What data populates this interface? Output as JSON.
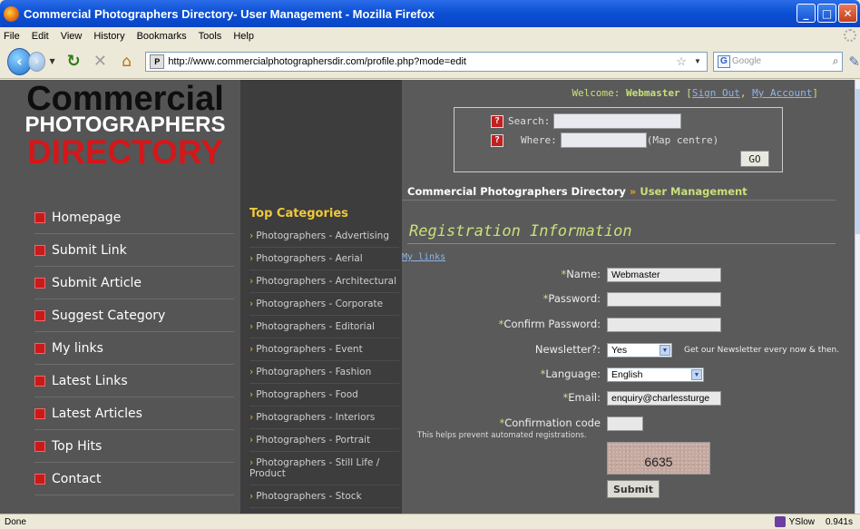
{
  "window": {
    "title": "Commercial Photographers Directory- User Management - Mozilla Firefox",
    "buttons": {
      "minimize": "_",
      "maximize": "□",
      "close": "✕"
    }
  },
  "menu": [
    "File",
    "Edit",
    "View",
    "History",
    "Bookmarks",
    "Tools",
    "Help"
  ],
  "toolbar": {
    "url": "http://www.commercialphotographersdir.com/profile.php?mode=edit",
    "search_placeholder": "Google"
  },
  "logo": {
    "line1": "Commercial",
    "line2": "PHOTOGRAPHERS",
    "line3": "DIRECTORY"
  },
  "leftnav": [
    "Homepage",
    "Submit Link",
    "Submit Article",
    "Suggest Category",
    "My links",
    "Latest Links",
    "Latest Articles",
    "Top Hits",
    "Contact"
  ],
  "categories": {
    "title": "Top Categories",
    "items": [
      "Photographers - Advertising",
      "Photographers - Aerial",
      "Photographers - Architectural",
      "Photographers - Corporate",
      "Photographers - Editorial",
      "Photographers - Event",
      "Photographers - Fashion",
      "Photographers - Food",
      "Photographers - Interiors",
      "Photographers - Portrait",
      "Photographers - Still Life / Product",
      "Photographers - Stock"
    ]
  },
  "welcome": {
    "prefix": "Welcome:",
    "user": "Webmaster",
    "sign_out": "Sign Out",
    "my_account": "My Account"
  },
  "search": {
    "search_label": "Search:",
    "where_label": "Where:",
    "map_note": "(Map centre)",
    "go": "GO"
  },
  "breadcrumb": {
    "home": "Commercial Photographers Directory",
    "sep": "»",
    "current": "User Management"
  },
  "form": {
    "title": "Registration Information",
    "mylinks": "My links",
    "name_label": "Name:",
    "name_value": "Webmaster",
    "password_label": "Password:",
    "confirm_label": "Confirm Password:",
    "newsletter_label": "Newsletter?:",
    "newsletter_value": "Yes",
    "newsletter_note": "Get our Newsletter every now & then.",
    "language_label": "Language:",
    "language_value": "English",
    "email_label": "Email:",
    "email_value": "enquiry@charlessturge",
    "confcode_label": "Confirmation code",
    "confcode_sub": "This helps prevent automated registrations.",
    "captcha": "6635",
    "submit": "Submit",
    "req": "*"
  },
  "status": {
    "text": "Done",
    "yslow": "YSlow",
    "time": "0.941s"
  },
  "colors": {
    "accent_green": "#c8e07a",
    "logo_red": "#d4171a",
    "category_gold": "#f0c93a"
  }
}
